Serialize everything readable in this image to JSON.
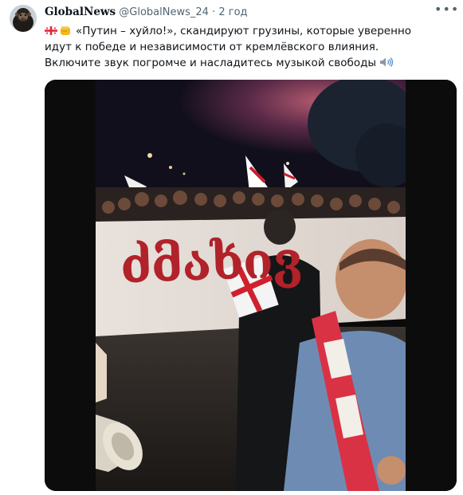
{
  "account": {
    "display_name": "GlobalNews",
    "handle": "@GlobalNews_24",
    "separator": "·",
    "time": "2 год"
  },
  "tweet": {
    "text": "«Путин – хуйло!», скандируют грузины, которые уверенно идут к победе и независимости от кремлёвского влияния. Включите звук погромче и насладитесь музыкой свободы"
  },
  "media": {
    "banner_text": "ძმახივ"
  },
  "icons": {
    "more": "more-icon",
    "flag": "georgia-flag-icon",
    "fist": "raised-fist-icon",
    "speaker": "speaker-icon"
  },
  "colors": {
    "flag_red": "#e0283a",
    "banner_red": "#b1222a",
    "secondary_text": "#536471"
  }
}
